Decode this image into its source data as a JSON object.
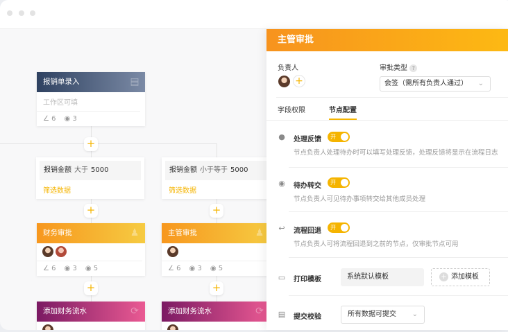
{
  "canvas": {
    "start": {
      "title": "报销单录入",
      "subtitle": "工作区可填",
      "edit": "6",
      "view": "3"
    },
    "cond_left": {
      "field": "报销金额",
      "op": "大于",
      "value": "5000",
      "filter": "筛选数据"
    },
    "cond_right": {
      "field": "报销金额",
      "op": "小于等于",
      "value": "5000",
      "filter": "筛选数据"
    },
    "finance": {
      "title": "财务审批",
      "edit": "6",
      "view": "3",
      "other": "5"
    },
    "manager": {
      "title": "主管审批",
      "edit": "6",
      "view": "3",
      "other": "5"
    },
    "flow_left": {
      "title": "添加财务流水"
    },
    "flow_right": {
      "title": "添加财务流水"
    }
  },
  "panel": {
    "title": "主管审批",
    "owner_label": "负责人",
    "type_label": "审批类型",
    "type_value": "会签（需所有负责人通过）",
    "tabs": [
      "字段权限",
      "节点配置"
    ],
    "items": [
      {
        "title": "处理反馈",
        "toggle": "开",
        "desc": "节点负责人处理待办时可以填写处理反馈，处理反馈将显示在流程日志"
      },
      {
        "title": "待办转交",
        "toggle": "开",
        "desc": "节点负责人可见待办事项转交给其他成员处理"
      },
      {
        "title": "流程回退",
        "toggle": "开",
        "desc": "节点负责人可将流程回退到之前的节点，仅审批节点可用"
      }
    ],
    "print_label": "打印模板",
    "print_value": "系统默认模板",
    "add_template": "添加模板",
    "submit_label": "提交校验",
    "submit_value": "所有数据可提交"
  }
}
